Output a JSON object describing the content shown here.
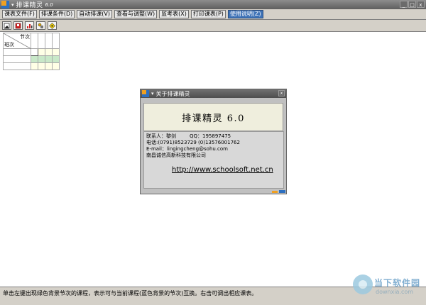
{
  "app": {
    "title": "排课精灵",
    "version": "6.0"
  },
  "window_controls": {
    "minimize": "_",
    "maximize": "□",
    "close": "x"
  },
  "menu": [
    {
      "label": "课表文件(F)"
    },
    {
      "label": "排课条件(D)"
    },
    {
      "label": "自动排课(V)"
    },
    {
      "label": "查看与调整(W)"
    },
    {
      "label": "监考表(X)"
    },
    {
      "label": "打印课表(P)"
    },
    {
      "label": "使用说明(Z)"
    }
  ],
  "toolbar_icons": [
    "new-file-icon",
    "open-file-icon",
    "chart-icon",
    "lock-key-icon",
    "help-diamond-icon"
  ],
  "grid": {
    "header_top": "节次",
    "header_left": "班次"
  },
  "dialog": {
    "title": "关于排课精灵",
    "close": "x",
    "product_name": "排课精灵 6.0",
    "contact": "联系人：黎剑",
    "qq": "QQ：195897475",
    "phone": "电话:(0791)8523729    (0)13576001762",
    "email": "E-mail：lingingcheng@sohu.com",
    "company": "南昌诚信高新科技有限公司",
    "url": "http://www.schoolsoft.net.cn"
  },
  "status": {
    "text": "单击左键出现绿色背景节次的课程，表示可与当前课程(蓝色背景的节次)互换。右击可调出相应课表。"
  },
  "watermark": {
    "name": "当下软件园",
    "site": "downxia.com"
  },
  "colors": {
    "accent_blue": "#3f73b7",
    "logo_orange": "#f0a020",
    "highlight_green": "#c8e8c8"
  }
}
